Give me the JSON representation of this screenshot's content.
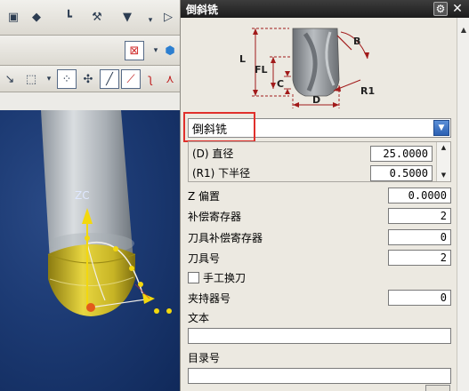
{
  "dialog": {
    "title": "倒斜铣",
    "gear_icon": "gear-icon",
    "close_icon": "close-icon"
  },
  "diagram": {
    "labels": {
      "L": "L",
      "FL": "FL",
      "C": "C",
      "D": "D",
      "B": "B",
      "R1": "R1"
    }
  },
  "tool_type": {
    "selected": "倒斜铣"
  },
  "dimensions": [
    {
      "label": "(D) 直径",
      "value": "25.0000"
    },
    {
      "label": "(R1) 下半径",
      "value": "0.5000"
    }
  ],
  "fields": {
    "z_offset": {
      "label": "Z 偏置",
      "value": "0.0000"
    },
    "adjust_register": {
      "label": "补偿寄存器",
      "value": "2"
    },
    "cutcom_register": {
      "label": "刀具补偿寄存器",
      "value": "0"
    },
    "tool_number": {
      "label": "刀具号",
      "value": "2"
    },
    "manual_change": {
      "label": "手工换刀"
    },
    "holder_number": {
      "label": "夹持器号",
      "value": "0"
    },
    "text": {
      "label": "文本",
      "value": ""
    },
    "library_ref": {
      "label": "目录号",
      "value": ""
    }
  },
  "viewport": {
    "axis_label": "ZC"
  },
  "colors": {
    "accent_red": "#e0302c",
    "viewport_blue": "#1c3a73",
    "tool_yellow": "#d8c020"
  }
}
